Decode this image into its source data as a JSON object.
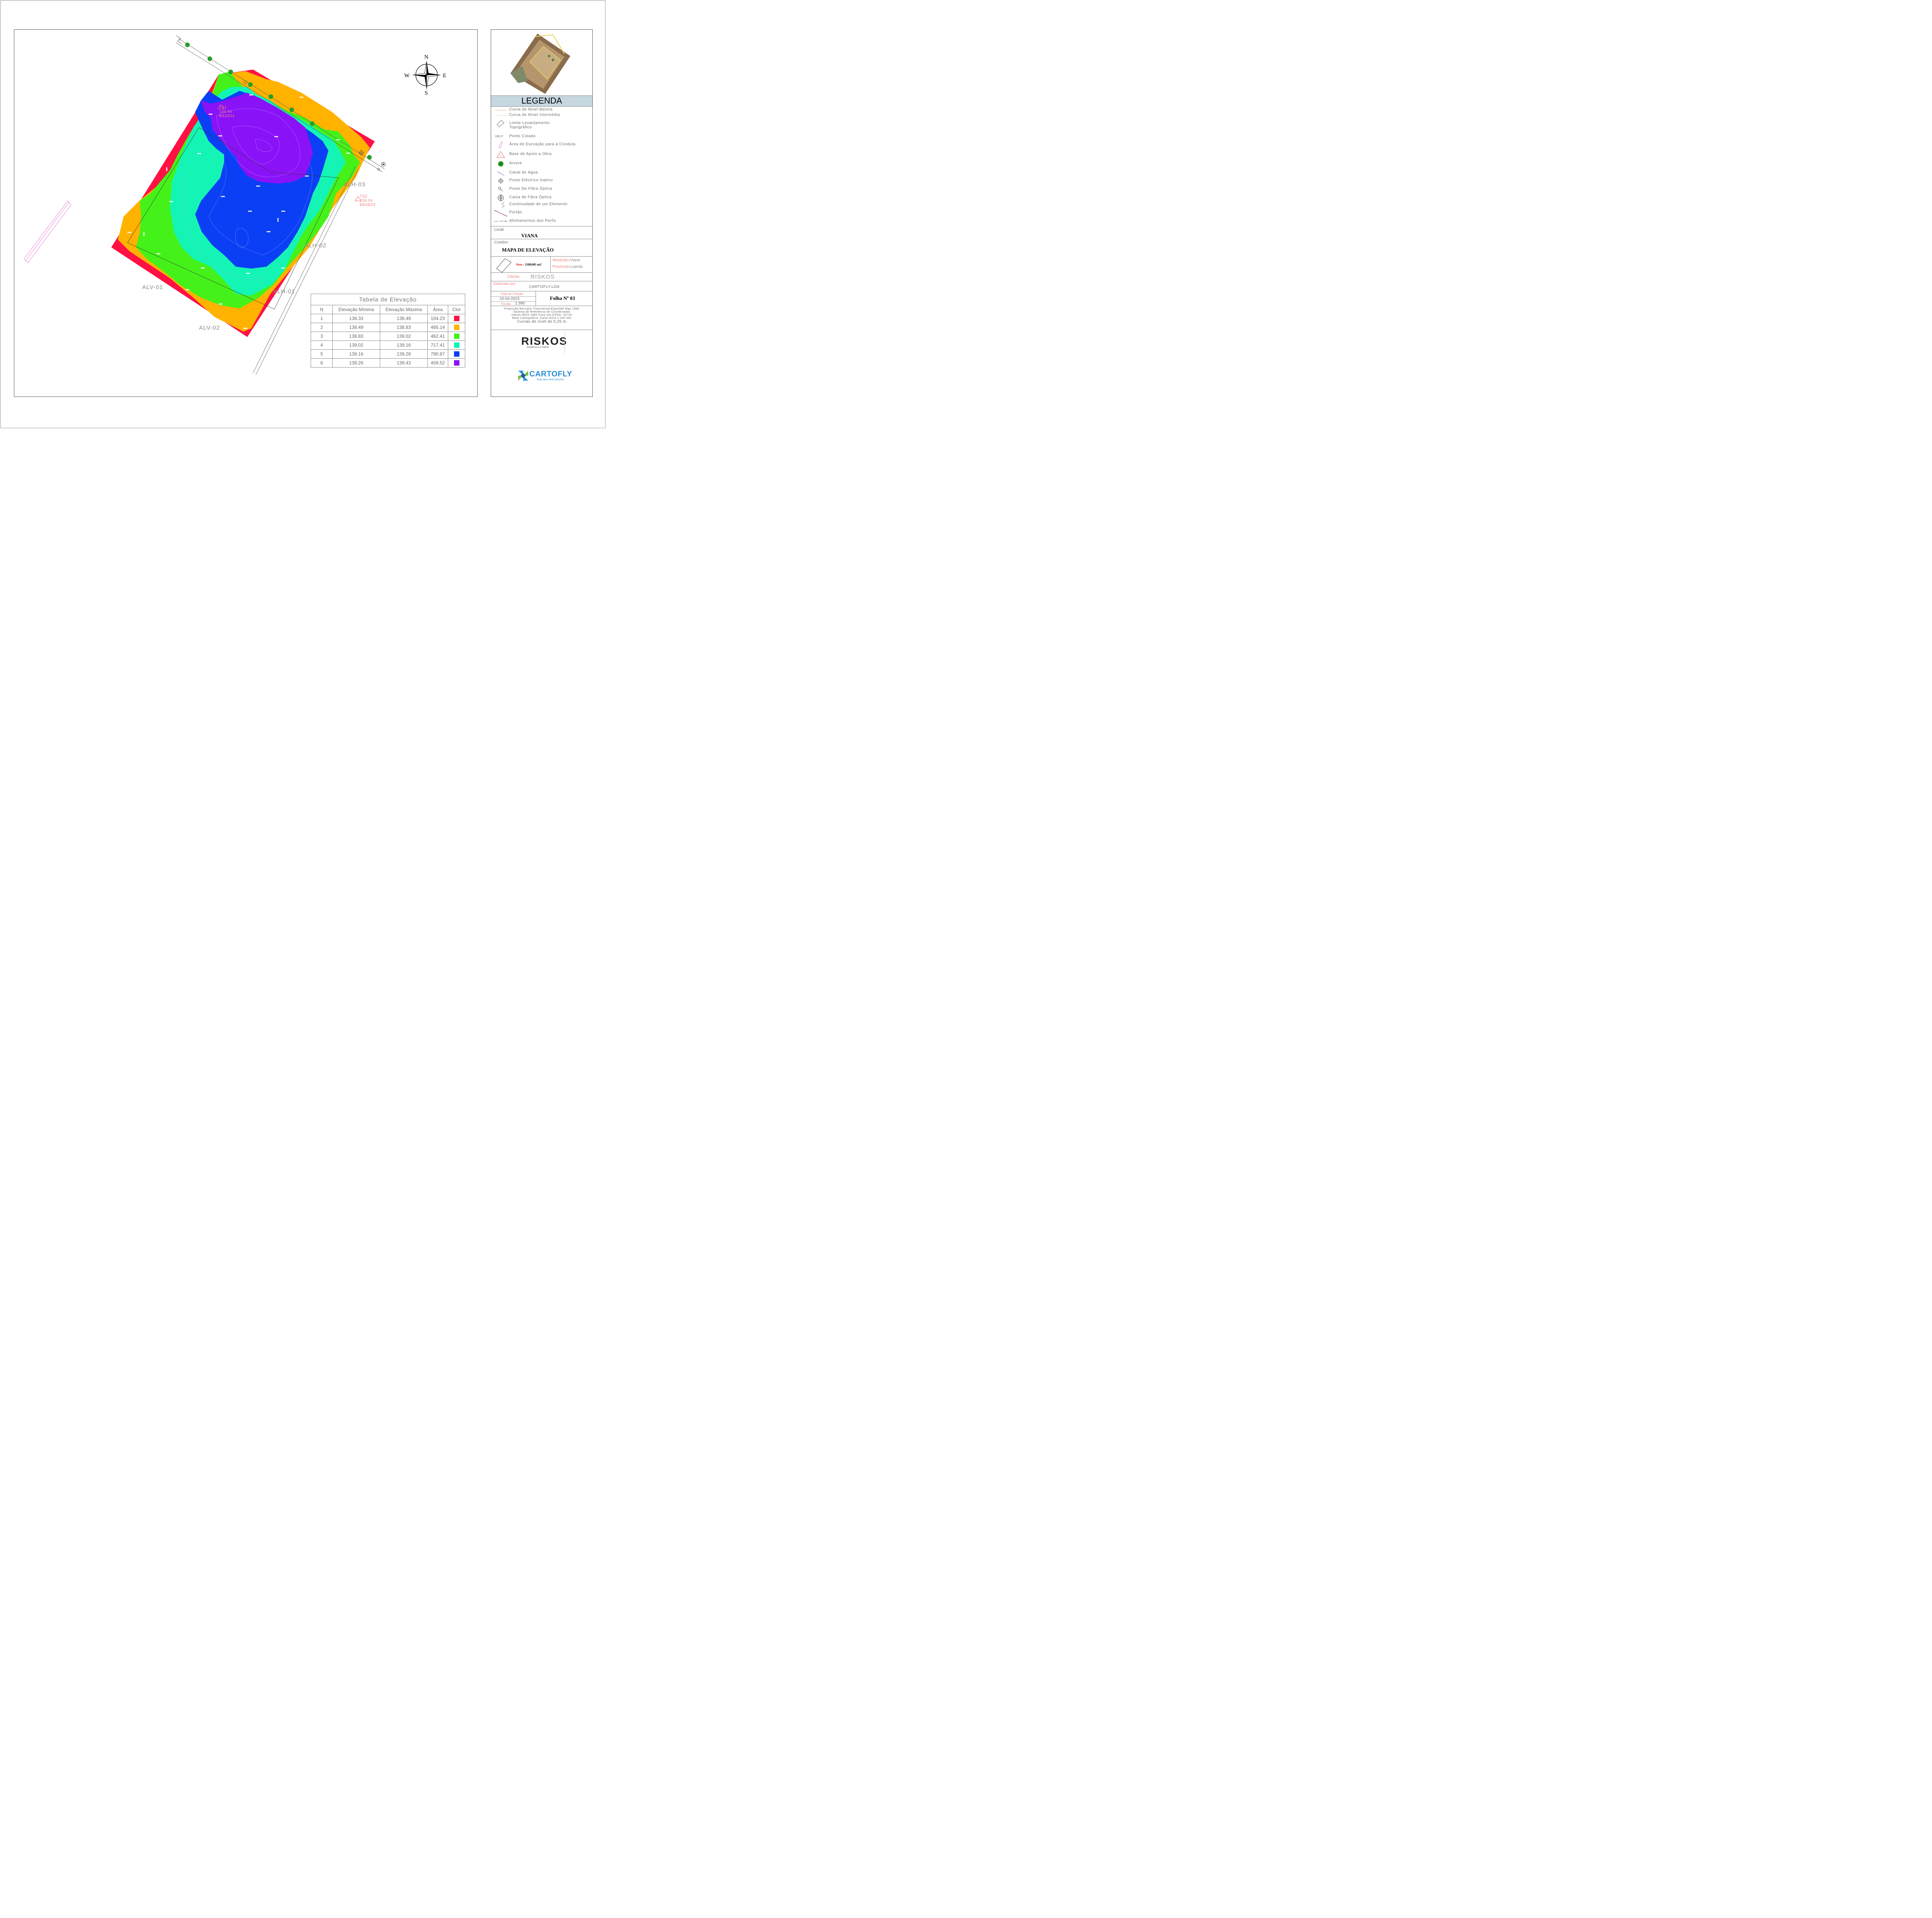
{
  "map": {
    "compass": {
      "north": "N",
      "south": "S",
      "east": "E",
      "west": "W"
    },
    "profile_labels": [
      "ALV-01",
      "ALV-02",
      "ALH-01",
      "ALH-02",
      "ALH-03"
    ],
    "bases": [
      {
        "id": "TS1",
        "elevation": "139.94",
        "name": "BASE01"
      },
      {
        "id": "TS2",
        "elevation": "139.04",
        "name": "BASE02"
      }
    ],
    "zone_colors": [
      "#ff1144",
      "#ffb300",
      "#44f21a",
      "#14f5b5",
      "#0b3ff5",
      "#8a12f7"
    ]
  },
  "elevation_table": {
    "title": "Tabela de Elevação",
    "headers": [
      "N",
      "Elevação Mínima",
      "Elevação Máxima",
      "Área",
      "Clor"
    ],
    "rows": [
      {
        "n": "1",
        "min": "138.33",
        "max": "138.49",
        "area": "104.23",
        "color": "#ff1144"
      },
      {
        "n": "2",
        "min": "138.49",
        "max": "138.83",
        "area": "485.14",
        "color": "#ffb300"
      },
      {
        "n": "3",
        "min": "138.83",
        "max": "139.02",
        "area": "462.41",
        "color": "#44f21a"
      },
      {
        "n": "4",
        "min": "139.02",
        "max": "139.16",
        "area": "717.41",
        "color": "#14f5b5"
      },
      {
        "n": "5",
        "min": "139.16",
        "max": "139.26",
        "area": "790.87",
        "color": "#0b3ff5"
      },
      {
        "n": "6",
        "min": "139.26",
        "max": "139.43",
        "area": "459.52",
        "color": "#8a12f7"
      }
    ]
  },
  "legend": {
    "title": "LEGENDA",
    "items": [
      {
        "label": "Curva de Nível Mestra",
        "icon": "master-contour-line-icon"
      },
      {
        "label": "Curva de Nível Intermédia",
        "icon": "intermediate-contour-line-icon"
      },
      {
        "label": "Limite Levantamento Topográfico",
        "icon": "survey-boundary-icon"
      },
      {
        "label": "Ponto Cotado",
        "icon": "spot-height-icon",
        "sample": "139.17"
      },
      {
        "label": "Área de Escvação para a Conduta",
        "icon": "excavation-area-icon"
      },
      {
        "label": "Base de Apoio a Obra",
        "icon": "support-base-triangle-icon"
      },
      {
        "label": "Arvore",
        "icon": "tree-icon"
      },
      {
        "label": "Canal de Água",
        "icon": "water-channel-icon"
      },
      {
        "label": "Poste Eléctrico Inativo",
        "icon": "electric-pole-icon"
      },
      {
        "label": "Poste De Fibra Óptica",
        "icon": "fiber-pole-icon"
      },
      {
        "label": "Caixa de Fibra Óptica",
        "icon": "fiber-box-icon"
      },
      {
        "label": "Continuidade de um Elemento",
        "icon": "continuity-icon"
      },
      {
        "label": "Portão",
        "icon": "gate-icon"
      },
      {
        "label": "Alinhamentos dos Perfiz",
        "icon": "profile-alignment-icon",
        "sample": "ALH-01"
      }
    ]
  },
  "info": {
    "local_label": "Local:",
    "local_value": "VIANA",
    "contem_label": "Contém:",
    "contem_value": "MAPA DE ELEVAÇÃO",
    "area_label": "Área",
    "area_value": "- 2108,081 m2",
    "municipio_label": "Município:",
    "municipio_value": "Viana",
    "provincia_label": "Província:",
    "provincia_value": "Luanda",
    "cliente_label": "Cliente:",
    "cliente_value": "RISKOS",
    "elaborado_label": "Elaborado por:",
    "elaborado_value": "CARTOFLY,LDA",
    "data_label": "Data de Criação:",
    "data_value": "10-04-2023",
    "escala_label": "Escala:",
    "escala_value": "1:390",
    "folha": "Folha Nº 03",
    "projection_lines": [
      "Projecção Mercator Transversal-Elipsóide Wgs 1984",
      "Sistema de Referência de Coordenadas",
      "Datum WGS 1984 Zona 33s EPSG: 32733",
      "Base Cartográfica: Carta IGCA 1:100 000",
      "Curvas de nível de 0,25 m"
    ]
  },
  "logos": {
    "riskos_name": "RISKOS",
    "riskos_tagline": "Arquitectura & Interior",
    "cartofly_name": "CARTOFLY",
    "cartofly_tagline": "Tudo que você precisa"
  }
}
